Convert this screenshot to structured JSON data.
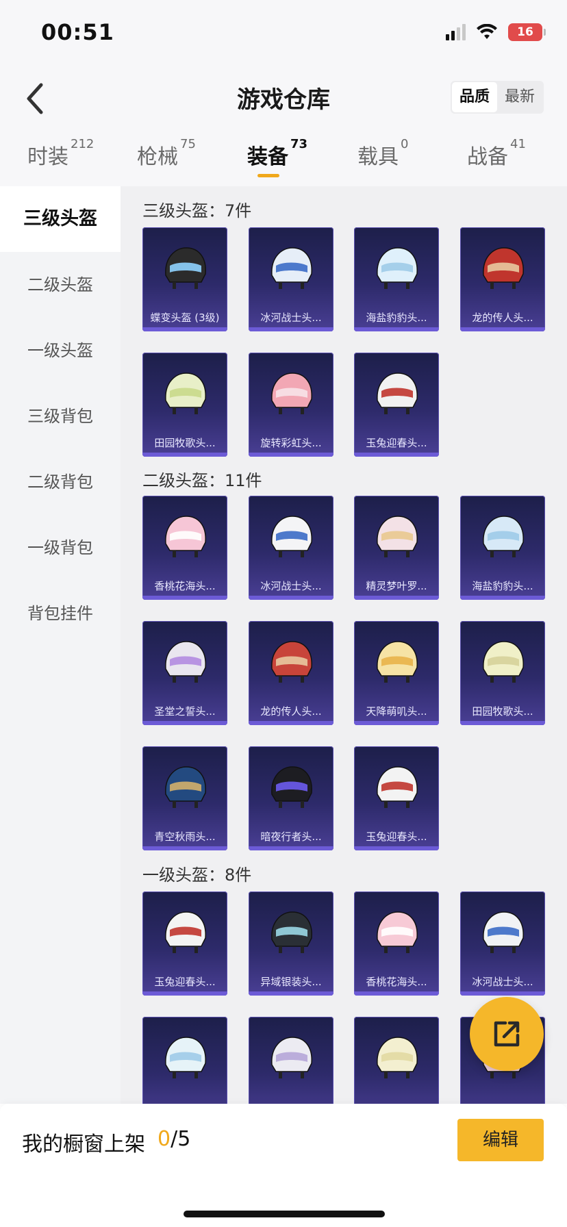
{
  "status": {
    "time": "00:51",
    "battery": "16"
  },
  "nav": {
    "title": "游戏仓库",
    "sort_options": [
      "品质",
      "最新"
    ]
  },
  "tabs": [
    {
      "label": "时装",
      "count": "212"
    },
    {
      "label": "枪械",
      "count": "75"
    },
    {
      "label": "装备",
      "count": "73"
    },
    {
      "label": "载具",
      "count": "0"
    },
    {
      "label": "战备",
      "count": "41"
    }
  ],
  "sidebar": [
    "三级头盔",
    "二级头盔",
    "一级头盔",
    "三级背包",
    "二级背包",
    "一级背包",
    "背包挂件"
  ],
  "sections": [
    {
      "title": "三级头盔：7件",
      "items": [
        "蝶变头盔 (3级)",
        "冰河战士头...",
        "海盐豹豹头...",
        "龙的传人头...",
        "田园牧歌头...",
        "旋转彩虹头...",
        "玉兔迎春头..."
      ]
    },
    {
      "title": "二级头盔：11件",
      "items": [
        "香桃花海头...",
        "冰河战士头...",
        "精灵梦叶罗...",
        "海盐豹豹头...",
        "圣堂之誓头...",
        "龙的传人头...",
        "天降萌叽头...",
        "田园牧歌头...",
        "青空秋雨头...",
        "暗夜行者头...",
        "玉兔迎春头..."
      ]
    },
    {
      "title": "一级头盔：8件",
      "items": [
        "玉兔迎春头...",
        "异域银装头...",
        "香桃花海头...",
        "冰河战士头...",
        "",
        "",
        "",
        ""
      ]
    }
  ],
  "bottom": {
    "label": "我的橱窗上架",
    "current": "0",
    "total": "/5",
    "edit_label": "编辑"
  },
  "colors": {
    "accent": "#f5b72a",
    "card_bg": "#2d2a6a"
  }
}
